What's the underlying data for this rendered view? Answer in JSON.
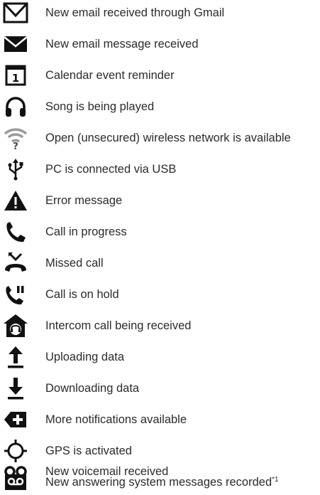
{
  "legend": {
    "items": [
      {
        "icon": "gmail-envelope-icon",
        "label": "New email received through Gmail"
      },
      {
        "icon": "email-envelope-icon",
        "label": "New email message received"
      },
      {
        "icon": "calendar-icon",
        "label": "Calendar event reminder"
      },
      {
        "icon": "headphones-icon",
        "label": "Song is being played"
      },
      {
        "icon": "wifi-open-icon",
        "label": "Open (unsecured) wireless network is available"
      },
      {
        "icon": "usb-icon",
        "label": "PC is connected via USB"
      },
      {
        "icon": "warning-triangle-icon",
        "label": "Error message"
      },
      {
        "icon": "phone-call-icon",
        "label": "Call in progress"
      },
      {
        "icon": "missed-call-icon",
        "label": "Missed call"
      },
      {
        "icon": "call-hold-icon",
        "label": "Call is on hold"
      },
      {
        "icon": "intercom-house-icon",
        "label": "Intercom call being received"
      },
      {
        "icon": "upload-arrow-icon",
        "label": "Uploading data"
      },
      {
        "icon": "download-arrow-icon",
        "label": "Downloading data"
      },
      {
        "icon": "more-notifications-icon",
        "label": "More notifications available"
      },
      {
        "icon": "gps-icon",
        "label": "GPS is activated"
      },
      {
        "icon": "voicemail-icon",
        "label": "New voicemail received"
      },
      {
        "icon": "answering-machine-icon",
        "label": "New answering system messages recorded",
        "footnote": "*1"
      }
    ],
    "calendar_day": "1"
  }
}
